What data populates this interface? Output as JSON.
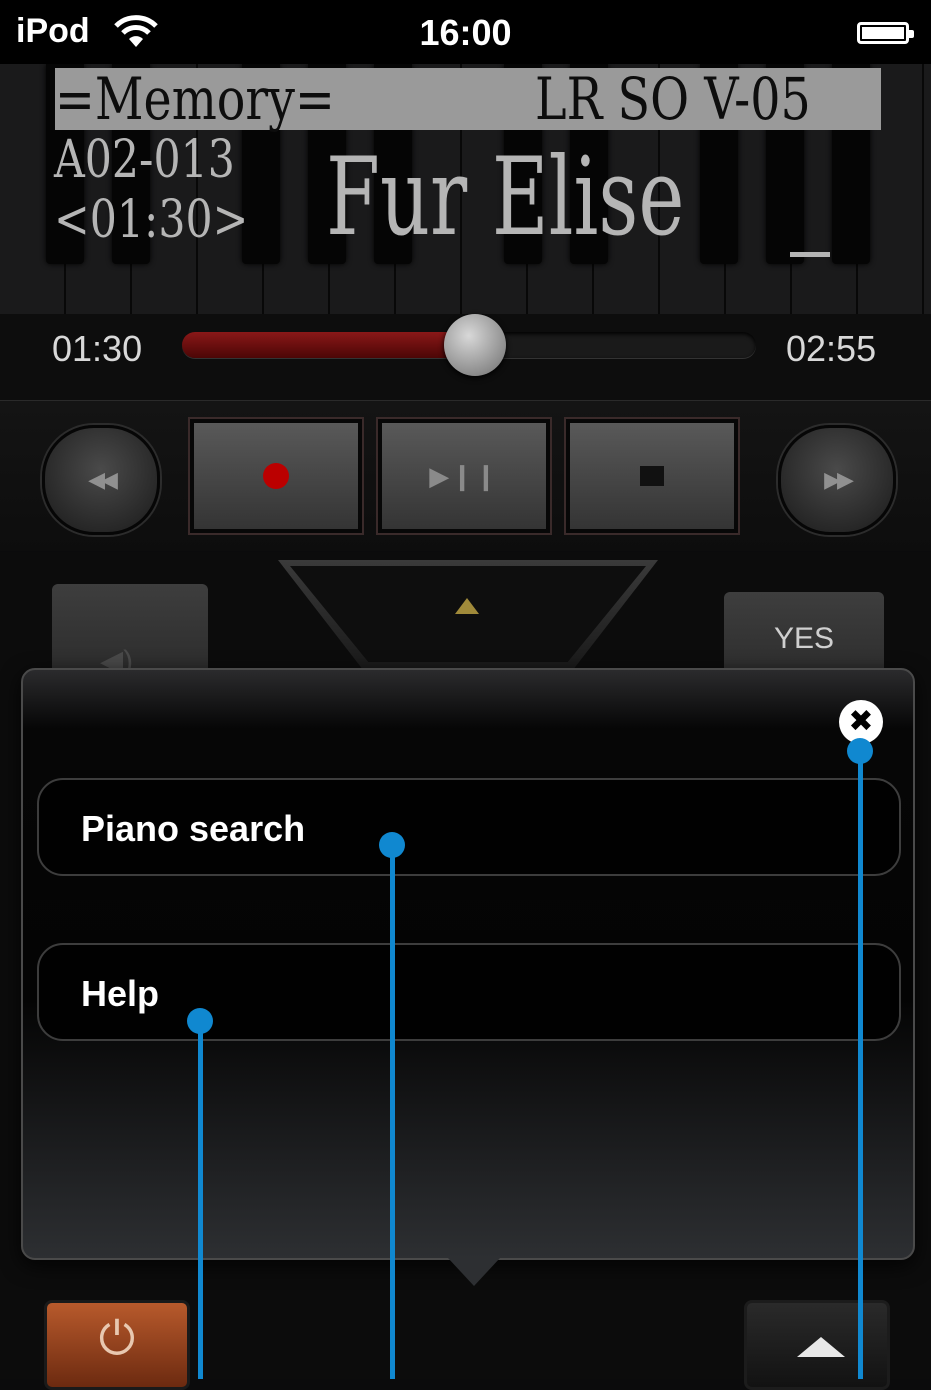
{
  "status_bar": {
    "carrier": "iPod",
    "time": "16:00"
  },
  "display": {
    "mode": "=Memory=",
    "settings": "LR SO V-05",
    "song_id": "A02-013",
    "song_time": "<01:30>",
    "song_title": "Fur Elise"
  },
  "progress": {
    "elapsed": "01:30",
    "total": "02:55",
    "fraction": 0.51
  },
  "controls": {
    "yes_label": "YES"
  },
  "menu": {
    "items": [
      {
        "label": "Piano search"
      },
      {
        "label": "Help"
      }
    ]
  },
  "colors": {
    "accent_callout": "#1088d0",
    "record": "#bb0000",
    "power": "#b85a2c"
  }
}
